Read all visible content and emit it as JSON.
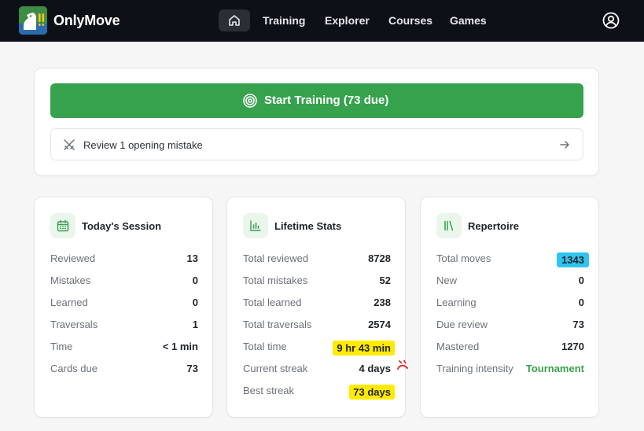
{
  "nav": {
    "brand": "OnlyMove",
    "links": [
      "Training",
      "Explorer",
      "Courses",
      "Games"
    ]
  },
  "training": {
    "start_label": "Start Training (73 due)",
    "review_label": "Review 1 opening mistake"
  },
  "session": {
    "title": "Today's Session",
    "rows": [
      {
        "label": "Reviewed",
        "value": "13"
      },
      {
        "label": "Mistakes",
        "value": "0"
      },
      {
        "label": "Learned",
        "value": "0"
      },
      {
        "label": "Traversals",
        "value": "1"
      },
      {
        "label": "Time",
        "value": "< 1 min"
      },
      {
        "label": "Cards due",
        "value": "73"
      }
    ]
  },
  "lifetime": {
    "title": "Lifetime Stats",
    "rows": [
      {
        "label": "Total reviewed",
        "value": "8728"
      },
      {
        "label": "Total mistakes",
        "value": "52"
      },
      {
        "label": "Total learned",
        "value": "238"
      },
      {
        "label": "Total traversals",
        "value": "2574"
      },
      {
        "label": "Total time",
        "value": "9 hr 43 min"
      },
      {
        "label": "Current streak",
        "value": "4 days"
      },
      {
        "label": "Best streak",
        "value": "73 days"
      }
    ]
  },
  "repertoire": {
    "title": "Repertoire",
    "rows": [
      {
        "label": "Total moves",
        "value": "1343"
      },
      {
        "label": "New",
        "value": "0"
      },
      {
        "label": "Learning",
        "value": "0"
      },
      {
        "label": "Due review",
        "value": "73"
      },
      {
        "label": "Mastered",
        "value": "1270"
      },
      {
        "label": "Training intensity",
        "value": "Tournament"
      }
    ]
  },
  "colors": {
    "nav_bg": "#0d1117",
    "accent_green": "#36a24d",
    "highlight_yellow": "#ffea00",
    "highlight_blue": "#2fc4ee"
  },
  "icons": {
    "logo": "knight-logo-icon",
    "home": "home-icon",
    "user": "user-circle-icon",
    "start": "target-icon",
    "review": "crossed-swords-icon",
    "arrow": "arrow-right-icon",
    "session": "calendar-icon",
    "lifetime": "bar-chart-icon",
    "repertoire": "library-icon"
  }
}
